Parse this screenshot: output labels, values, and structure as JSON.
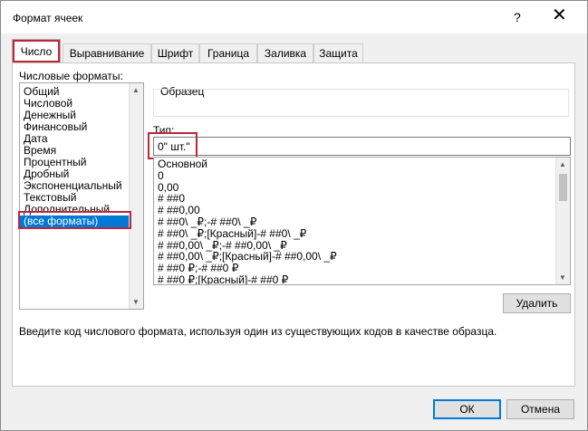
{
  "window": {
    "title": "Формат ячеек",
    "help": "?",
    "close": "✕"
  },
  "tabs": [
    {
      "label": "Число",
      "active": true
    },
    {
      "label": "Выравнивание"
    },
    {
      "label": "Шрифт"
    },
    {
      "label": "Граница"
    },
    {
      "label": "Заливка"
    },
    {
      "label": "Защита"
    }
  ],
  "categories": {
    "label": "Числовые форматы:",
    "items": [
      "Общий",
      "Числовой",
      "Денежный",
      "Финансовый",
      "Дата",
      "Время",
      "Процентный",
      "Дробный",
      "Экспоненциальный",
      "Текстовый",
      "Дополнительный",
      "(все форматы)"
    ],
    "selected_index": 11
  },
  "sample": {
    "label": "Образец",
    "value": ""
  },
  "type": {
    "label": "Тип:",
    "value": "0\" шт.\""
  },
  "formats": [
    "Основной",
    "0",
    "0,00",
    "# ##0",
    "# ##0,00",
    "# ##0\\ _₽;-# ##0\\ _₽",
    "# ##0\\ _₽;[Красный]-# ##0\\ _₽",
    "# ##0,00\\ _₽;-# ##0,00\\ _₽",
    "# ##0,00\\ _₽;[Красный]-# ##0,00\\ _₽",
    "# ##0 ₽;-# ##0 ₽",
    "# ##0 ₽;[Красный]-# ##0 ₽"
  ],
  "delete_button": "Удалить",
  "description": "Введите код числового формата, используя один из существующих кодов в качестве образца.",
  "ok_button": "ОК",
  "cancel_button": "Отмена",
  "colors": {
    "accent": "#0078d7",
    "highlight": "#c0263a"
  }
}
